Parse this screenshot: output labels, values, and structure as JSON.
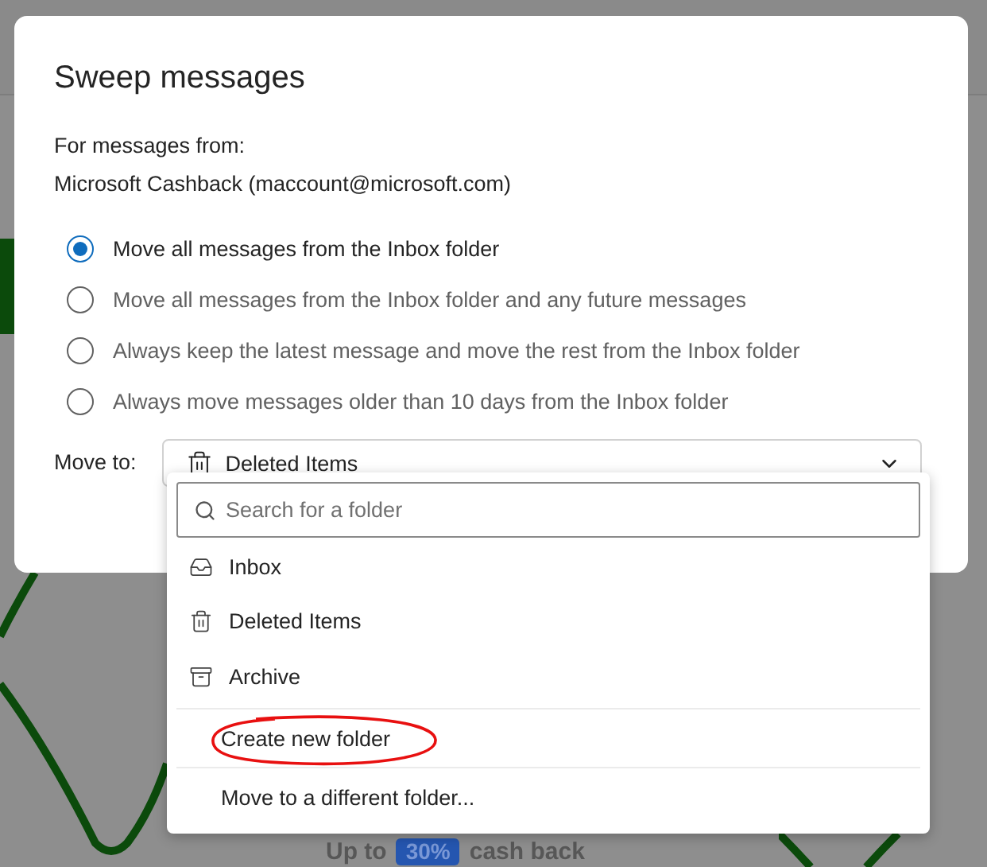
{
  "dialog": {
    "title": "Sweep messages",
    "from_label": "For messages from:",
    "sender": "Microsoft Cashback (maccount@microsoft.com)",
    "options": [
      {
        "label": "Move all messages from the Inbox folder",
        "selected": true
      },
      {
        "label": "Move all messages from the Inbox folder and any future messages",
        "selected": false
      },
      {
        "label": "Always keep the latest message and move the rest from the Inbox folder",
        "selected": false
      },
      {
        "label": "Always move messages older than 10 days from the Inbox folder",
        "selected": false
      }
    ],
    "move_to": {
      "label": "Move to:",
      "value": "Deleted Items"
    }
  },
  "folder_menu": {
    "search": {
      "placeholder": "Search for a folder"
    },
    "folders": [
      {
        "label": "Inbox",
        "kind": "inbox"
      },
      {
        "label": "Deleted Items",
        "kind": "trash"
      },
      {
        "label": "Archive",
        "kind": "archive"
      }
    ],
    "actions": [
      {
        "label": "Create new folder",
        "circled": true
      },
      {
        "label": "Move to a different folder...",
        "circled": false
      }
    ]
  },
  "background": {
    "promo": [
      "Up to",
      "30%",
      "cash back"
    ]
  }
}
